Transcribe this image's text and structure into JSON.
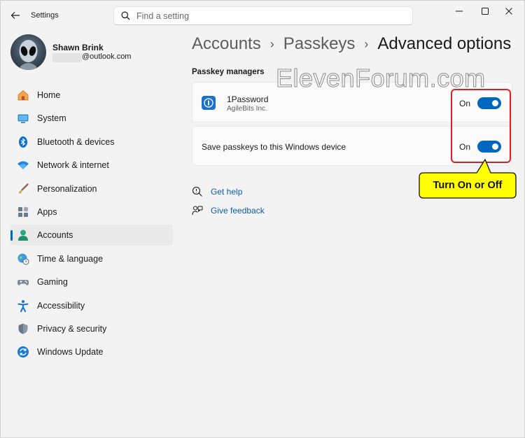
{
  "window": {
    "title": "Settings",
    "search_placeholder": "Find a setting"
  },
  "user": {
    "name": "Shawn Brink",
    "email": "@outlook.com"
  },
  "sidebar": {
    "items": [
      {
        "label": "Home",
        "icon": "home-icon"
      },
      {
        "label": "System",
        "icon": "system-icon"
      },
      {
        "label": "Bluetooth & devices",
        "icon": "bluetooth-icon"
      },
      {
        "label": "Network & internet",
        "icon": "wifi-icon"
      },
      {
        "label": "Personalization",
        "icon": "brush-icon"
      },
      {
        "label": "Apps",
        "icon": "apps-icon"
      },
      {
        "label": "Accounts",
        "icon": "accounts-icon",
        "active": true
      },
      {
        "label": "Time & language",
        "icon": "globe-icon"
      },
      {
        "label": "Gaming",
        "icon": "gamepad-icon"
      },
      {
        "label": "Accessibility",
        "icon": "accessibility-icon"
      },
      {
        "label": "Privacy & security",
        "icon": "shield-icon"
      },
      {
        "label": "Windows Update",
        "icon": "update-icon"
      }
    ]
  },
  "breadcrumb": {
    "items": [
      "Accounts",
      "Passkeys",
      "Advanced options"
    ],
    "separator": "›"
  },
  "main": {
    "section_title": "Passkey managers",
    "managers": [
      {
        "name": "1Password",
        "publisher": "AgileBits Inc.",
        "state": "On",
        "enabled": true
      },
      {
        "name": "Save passkeys to this Windows device",
        "state": "On",
        "enabled": true
      }
    ],
    "links": [
      {
        "label": "Get help",
        "icon": "help-icon"
      },
      {
        "label": "Give feedback",
        "icon": "feedback-icon"
      }
    ]
  },
  "annotation": {
    "watermark": "ElevenForum.com",
    "callout": "Turn On or Off",
    "callout_color": "#ffff00",
    "highlight_color": "#e02020"
  },
  "colors": {
    "accent": "#0067c0",
    "link": "#0b5cad",
    "background": "#f3f3f3",
    "card": "#fbfbfb"
  }
}
